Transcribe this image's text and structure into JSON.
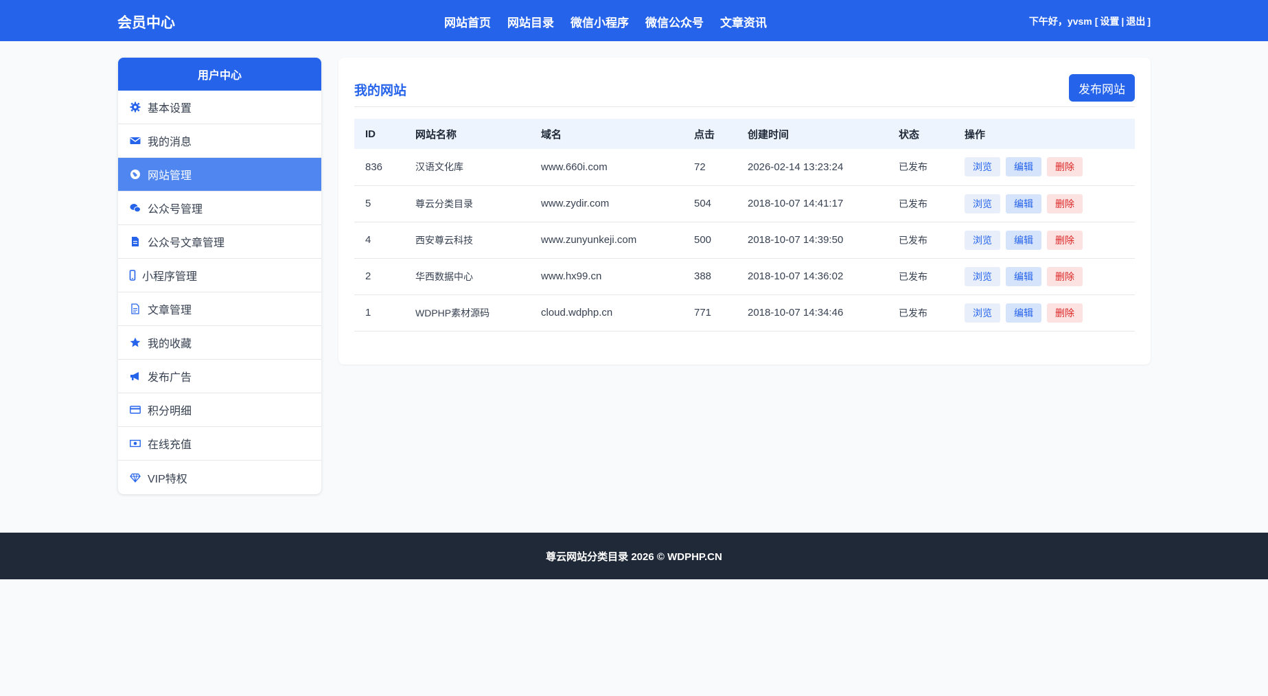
{
  "header": {
    "brand": "会员中心",
    "nav": [
      "网站首页",
      "网站目录",
      "微信小程序",
      "微信公众号",
      "文章资讯"
    ],
    "greeting": "下午好，",
    "username": "yvsm",
    "bracket_open": "[",
    "settings": "设置",
    "separator": "|",
    "logout": "退出",
    "bracket_close": "]"
  },
  "sidebar": {
    "title": "用户中心",
    "items": [
      {
        "label": "基本设置",
        "icon": "gear-icon"
      },
      {
        "label": "我的消息",
        "icon": "envelope-icon"
      },
      {
        "label": "网站管理",
        "icon": "globe-icon",
        "active": true
      },
      {
        "label": "公众号管理",
        "icon": "wechat-icon"
      },
      {
        "label": "公众号文章管理",
        "icon": "file-icon"
      },
      {
        "label": "小程序管理",
        "icon": "mobile-icon"
      },
      {
        "label": "文章管理",
        "icon": "file-text-icon"
      },
      {
        "label": "我的收藏",
        "icon": "star-icon"
      },
      {
        "label": "发布广告",
        "icon": "megaphone-icon"
      },
      {
        "label": "积分明细",
        "icon": "credit-card-icon"
      },
      {
        "label": "在线充值",
        "icon": "money-icon"
      },
      {
        "label": "VIP特权",
        "icon": "diamond-icon"
      }
    ]
  },
  "main": {
    "title": "我的网站",
    "publish_label": "发布网站",
    "columns": [
      "ID",
      "网站名称",
      "域名",
      "点击",
      "创建时间",
      "状态",
      "操作"
    ],
    "rows": [
      {
        "id": "836",
        "name": "汉语文化库",
        "domain": "www.660i.com",
        "hits": "72",
        "created": "2026-02-14 13:23:24",
        "status": "已发布"
      },
      {
        "id": "5",
        "name": "尊云分类目录",
        "domain": "www.zydir.com",
        "hits": "504",
        "created": "2018-10-07 14:41:17",
        "status": "已发布"
      },
      {
        "id": "4",
        "name": "西安尊云科技",
        "domain": "www.zunyunkeji.com",
        "hits": "500",
        "created": "2018-10-07 14:39:50",
        "status": "已发布"
      },
      {
        "id": "2",
        "name": "华西数据中心",
        "domain": "www.hx99.cn",
        "hits": "388",
        "created": "2018-10-07 14:36:02",
        "status": "已发布"
      },
      {
        "id": "1",
        "name": "WDPHP素材源码",
        "domain": "cloud.wdphp.cn",
        "hits": "771",
        "created": "2018-10-07 14:34:46",
        "status": "已发布"
      }
    ],
    "actions": {
      "view": "浏览",
      "edit": "编辑",
      "delete": "删除"
    }
  },
  "footer": {
    "text": "尊云网站分类目录 2026 © WDPHP.CN"
  },
  "colors": {
    "primary": "#2563eb",
    "active_item": "#4f86ef",
    "status_ok": "#16a34a",
    "danger": "#dc2626",
    "footer_bg": "#1f2937"
  }
}
